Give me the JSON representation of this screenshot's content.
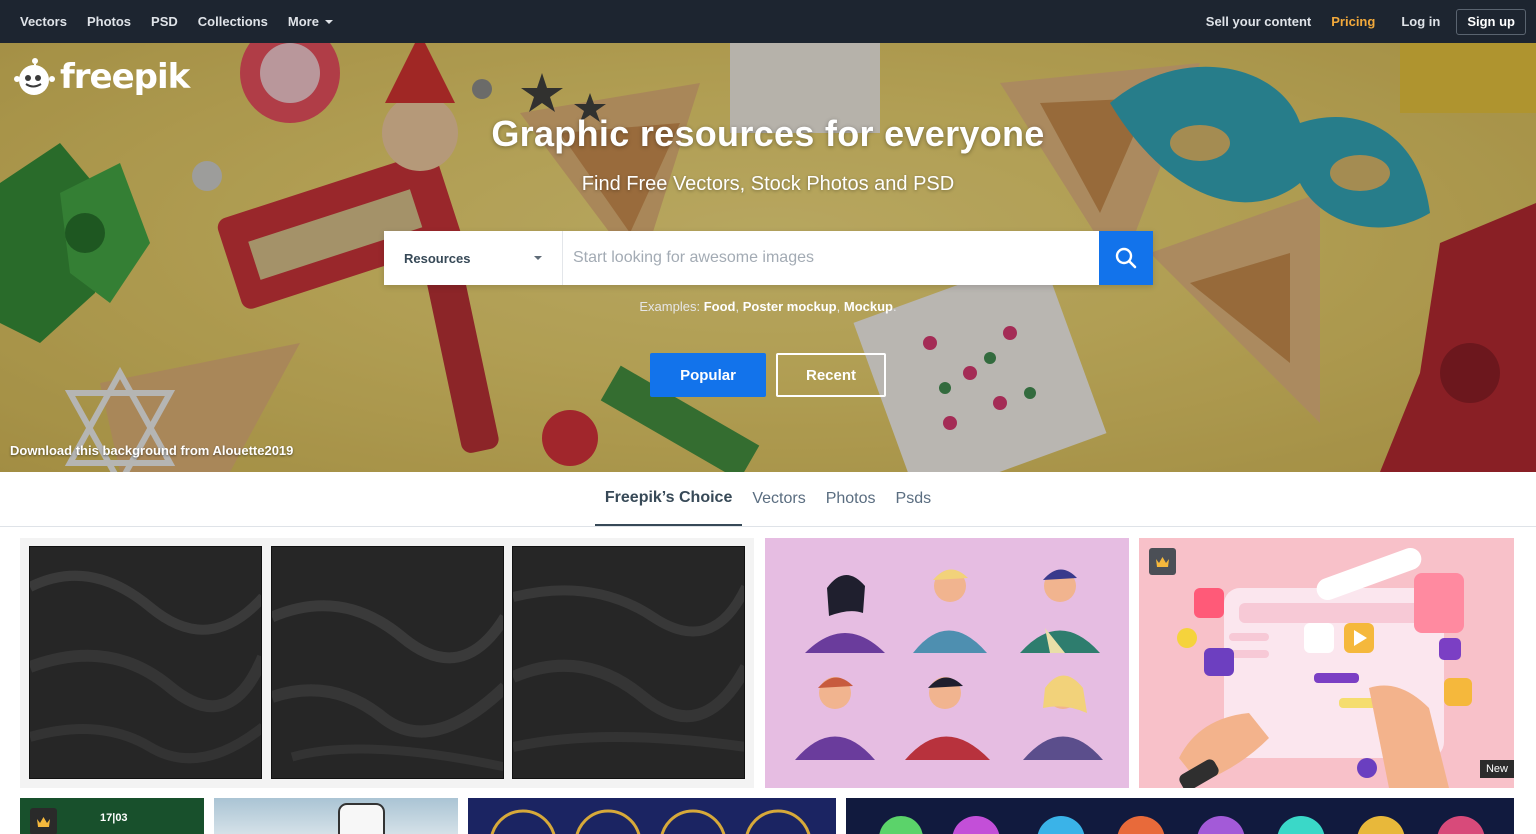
{
  "nav": {
    "left": [
      {
        "label": "Vectors"
      },
      {
        "label": "Photos"
      },
      {
        "label": "PSD"
      },
      {
        "label": "Collections"
      },
      {
        "label": "More"
      }
    ],
    "sell": "Sell your content",
    "pricing": "Pricing",
    "login": "Log in",
    "signup": "Sign up"
  },
  "logo": {
    "text": "freepik"
  },
  "hero": {
    "title": "Graphic resources for everyone",
    "subtitle": "Find Free Vectors, Stock Photos and PSD",
    "credit": "Download this background from Alouette2019"
  },
  "search": {
    "resource_label": "Resources",
    "placeholder": "Start looking for awesome images"
  },
  "examples": {
    "label": "Examples:",
    "items": [
      "Food",
      "Poster mockup",
      "Mockup"
    ]
  },
  "buttons": {
    "popular": "Popular",
    "recent": "Recent"
  },
  "tabs": [
    {
      "label": "Freepik’s Choice",
      "active": true
    },
    {
      "label": "Vectors"
    },
    {
      "label": "Photos"
    },
    {
      "label": "Psds"
    }
  ],
  "cards": {
    "ui3d_badge": "New",
    "row2a_text": "17|03"
  },
  "colors": {
    "nav_bg": "#1d2530",
    "accent_blue": "#1273eb",
    "pricing_orange": "#f2a93b"
  }
}
